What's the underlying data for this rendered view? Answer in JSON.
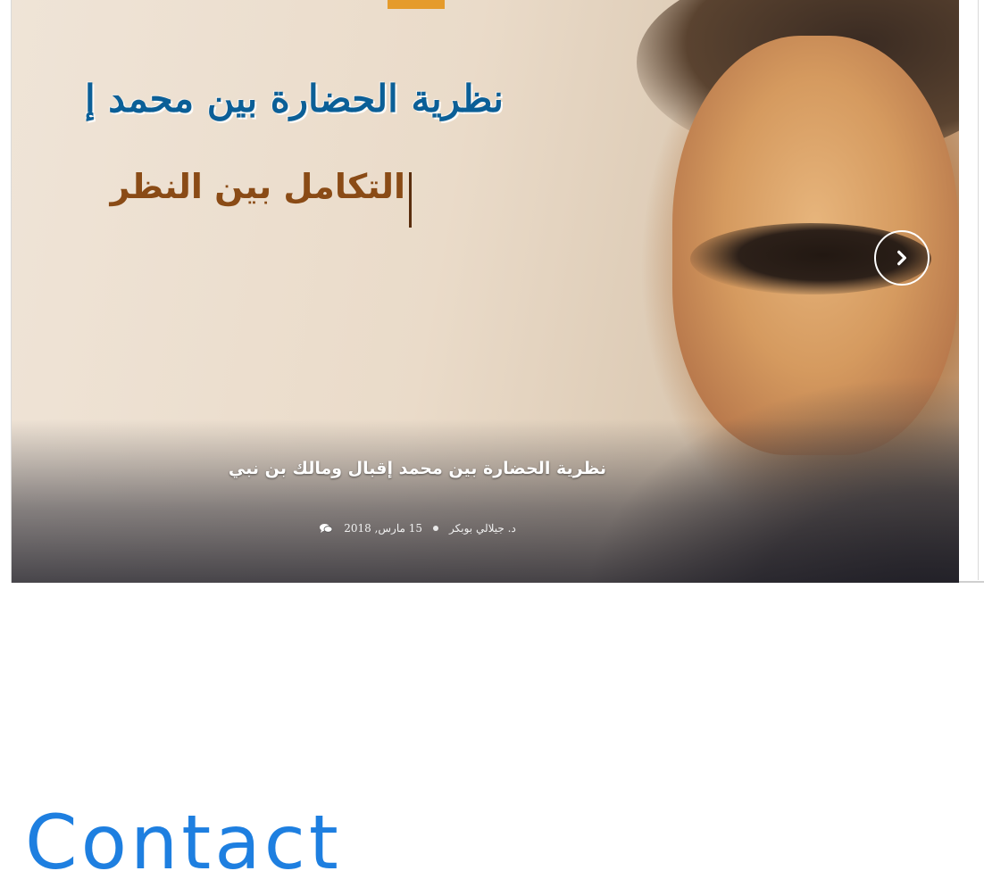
{
  "slider": {
    "image_text_line1": "نظرية الحضارة بين محمد إ",
    "image_text_line2": "التكامل بين النظر",
    "title": "نظرية الحضارة بين محمد إقبال ومالك بن نبي",
    "author": "د. جيلالي بوبكر",
    "date": "15 مارس, 2018",
    "comment_icon": "comment-icon",
    "next_icon": "chevron-right-icon",
    "accent_color": "#e59b2b"
  },
  "contact": {
    "heading": "Contact",
    "color": "#1e7fe0"
  }
}
